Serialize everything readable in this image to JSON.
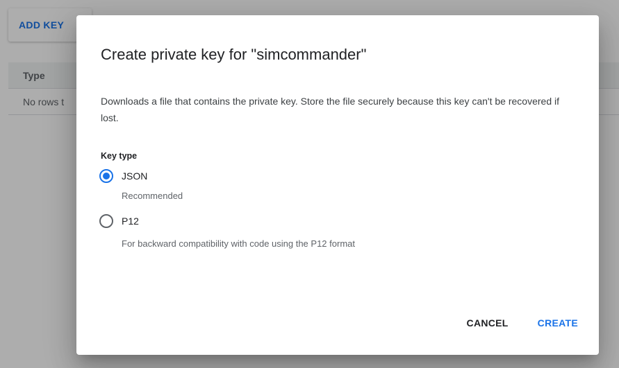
{
  "background": {
    "add_key_label": "ADD KEY",
    "table_header_type": "Type",
    "table_empty_text": "No rows t"
  },
  "dialog": {
    "title": "Create private key for \"simcommander\"",
    "description": "Downloads a file that contains the private key. Store the file securely because this key can't be recovered if lost.",
    "key_type_label": "Key type",
    "options": [
      {
        "label": "JSON",
        "sublabel": "Recommended",
        "selected": true
      },
      {
        "label": "P12",
        "sublabel": "For backward compatibility with code using the P12 format",
        "selected": false
      }
    ],
    "cancel_label": "CANCEL",
    "create_label": "CREATE"
  },
  "colors": {
    "accent": "#1a73e8",
    "scrim": "rgba(0,0,0,0.32)"
  }
}
